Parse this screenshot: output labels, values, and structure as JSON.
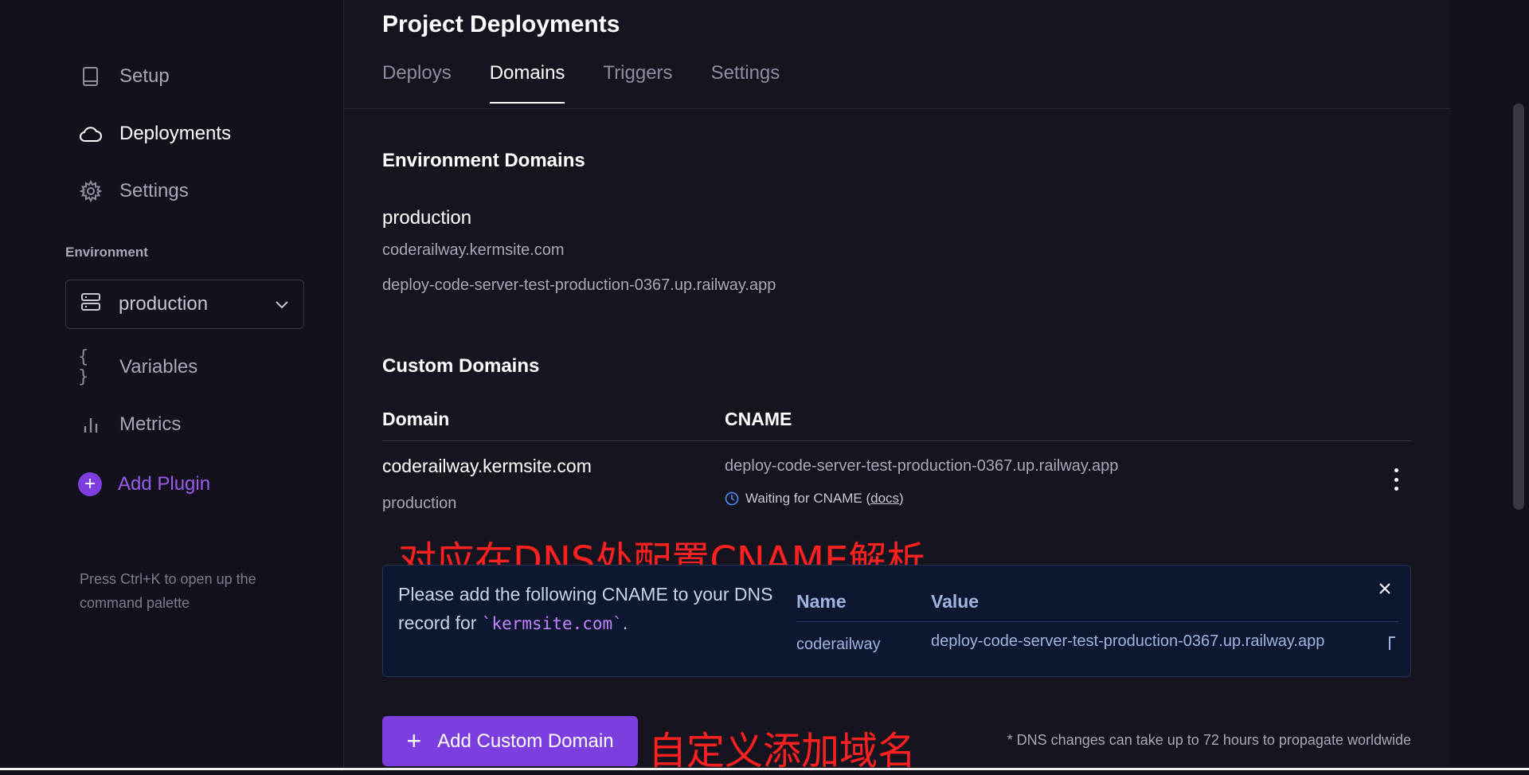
{
  "sidebar": {
    "items": [
      {
        "label": "Setup",
        "icon": "book-icon"
      },
      {
        "label": "Deployments",
        "icon": "cloud-icon",
        "active": true
      },
      {
        "label": "Settings",
        "icon": "gear-icon"
      }
    ],
    "environment_label": "Environment",
    "environment_value": "production",
    "items2": [
      {
        "label": "Variables",
        "icon": "braces-icon"
      },
      {
        "label": "Metrics",
        "icon": "bar-chart-icon"
      }
    ],
    "add_plugin_label": "Add Plugin",
    "hint": "Press Ctrl+K to open up the command palette"
  },
  "main": {
    "title": "Project Deployments",
    "tabs": [
      {
        "label": "Deploys"
      },
      {
        "label": "Domains",
        "active": true
      },
      {
        "label": "Triggers"
      },
      {
        "label": "Settings"
      }
    ],
    "environment_domains": {
      "heading": "Environment Domains",
      "env_name": "production",
      "urls": [
        "coderailway.kermsite.com",
        "deploy-code-server-test-production-0367.up.railway.app"
      ]
    },
    "custom_domains": {
      "heading": "Custom Domains",
      "col_domain": "Domain",
      "col_cname": "CNAME",
      "row": {
        "domain": "coderailway.kermsite.com",
        "env": "production",
        "cname": "deploy-code-server-test-production-0367.up.railway.app",
        "status_prefix": "Waiting for CNAME (",
        "status_link": "docs",
        "status_suffix": ")"
      }
    },
    "info": {
      "text_before": "Please add the following CNAME to your DNS record for ",
      "code": "`kermsite.com`",
      "text_after": ".",
      "col_name": "Name",
      "col_value": "Value",
      "name": "coderailway",
      "value": "deploy-code-server-test-production-0367.up.railway.app"
    },
    "add_button_label": "Add Custom Domain",
    "footnote": "* DNS changes can take up to 72 hours to propagate worldwide"
  },
  "annotations": {
    "dns_note": "对应在DNS处配置CNAME解析",
    "add_note": "自定义添加域名",
    "color": "#ff2020"
  },
  "colors": {
    "accent": "#7d3ee0",
    "background": "#13111c",
    "info_bg": "#0e1730"
  }
}
